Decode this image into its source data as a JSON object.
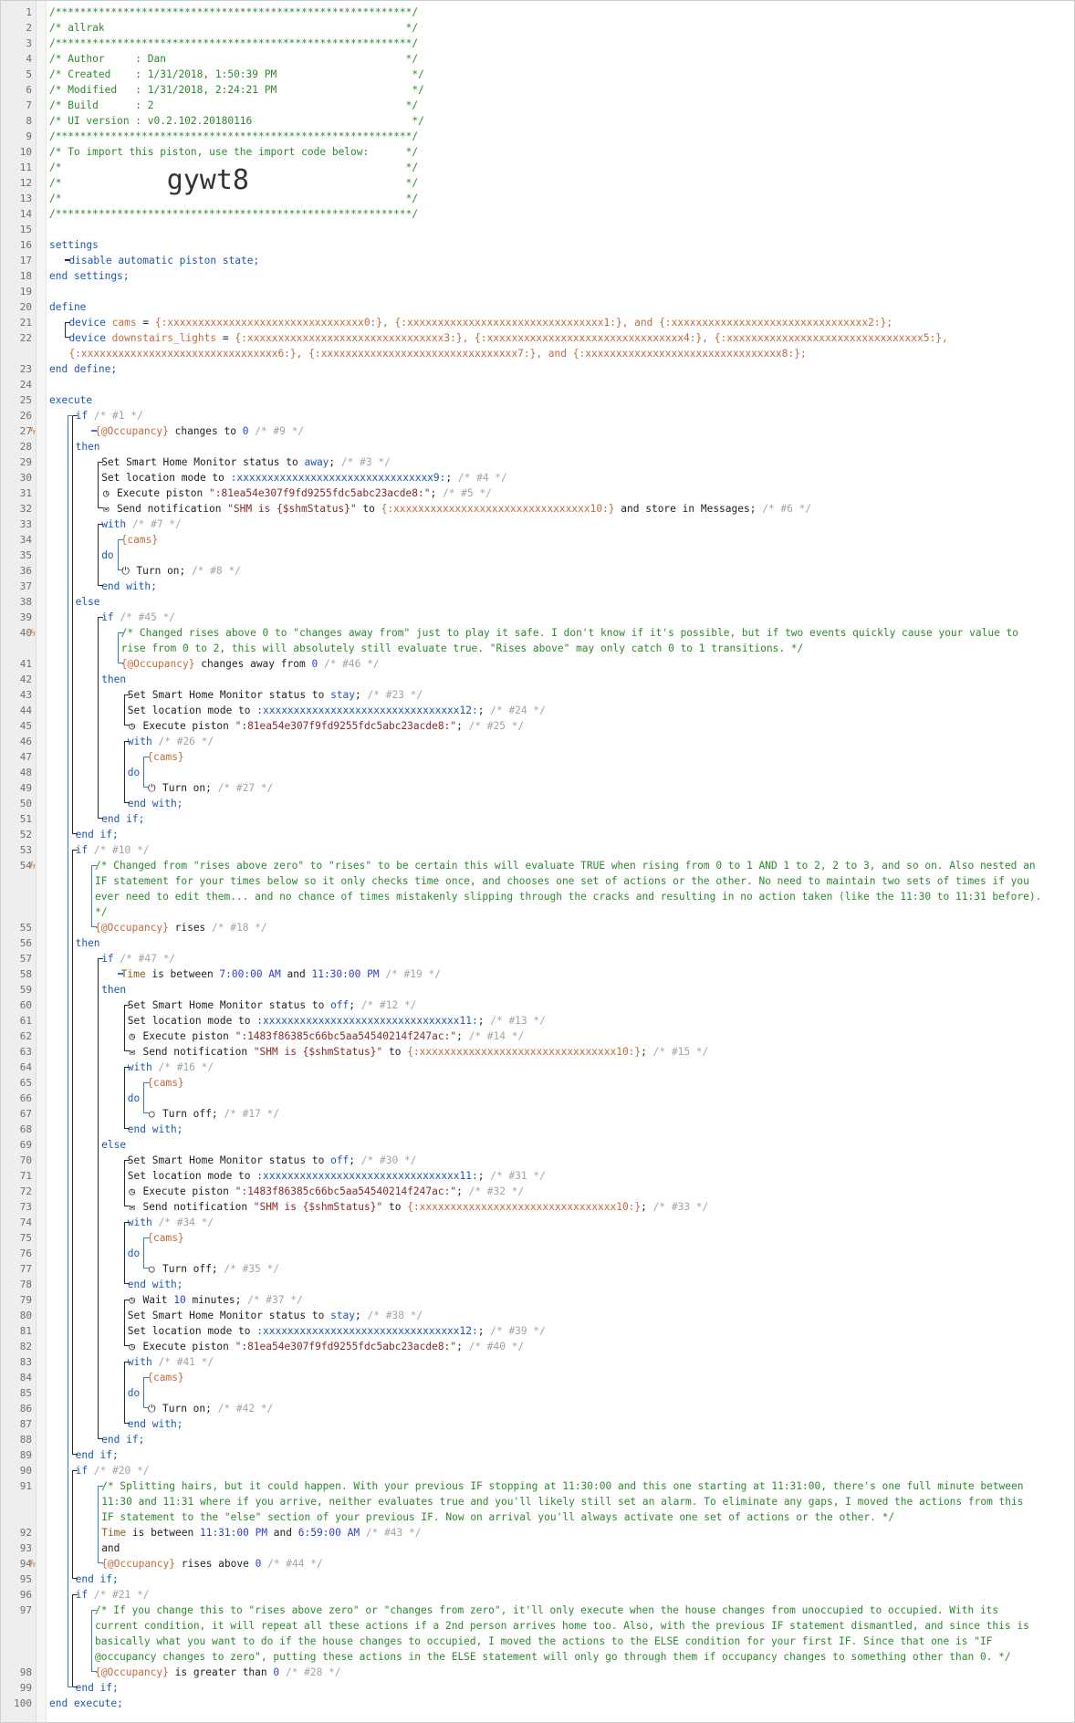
{
  "header_lines": [
    "/**********************************************************/",
    "/* allrak                                                 */",
    "/**********************************************************/",
    "/* Author     : Dan                                       */",
    "/* Created    : 1/31/2018, 1:50:39 PM                      */",
    "/* Modified   : 1/31/2018, 2:24:21 PM                      */",
    "/* Build      : 2                                         */",
    "/* UI version : v0.2.102.20180116                          */",
    "/**********************************************************/",
    "/* To import this piston, use the import code below:      */",
    "/*                                                        */",
    "/*                                                        */",
    "/*                                                        */",
    "/**********************************************************/"
  ],
  "import_code": "gywt8",
  "settings": {
    "open": "settings",
    "line": "disable automatic piston state;",
    "close": "end settings;"
  },
  "define": {
    "open": "define",
    "kw_device": "device",
    "cams_name": "cams",
    "cams_value": "{:xxxxxxxxxxxxxxxxxxxxxxxxxxxxxxxx0:}, {:xxxxxxxxxxxxxxxxxxxxxxxxxxxxxxxx1:}, and {:xxxxxxxxxxxxxxxxxxxxxxxxxxxxxxxx2:};",
    "lights_name": "downstairs_lights",
    "lights_value": "{:xxxxxxxxxxxxxxxxxxxxxxxxxxxxxxxx3:}, {:xxxxxxxxxxxxxxxxxxxxxxxxxxxxxxxx4:}, {:xxxxxxxxxxxxxxxxxxxxxxxxxxxxxxxx5:},",
    "lights_value2": "{:xxxxxxxxxxxxxxxxxxxxxxxxxxxxxxxx6:}, {:xxxxxxxxxxxxxxxxxxxxxxxxxxxxxxxx7:}, and {:xxxxxxxxxxxxxxxxxxxxxxxxxxxxxxxx8:};",
    "close": "end define;"
  },
  "tokens": {
    "execute": "execute",
    "end_execute": "end execute;",
    "if": "if",
    "then": "then",
    "else": "else",
    "end_if": "end if;",
    "with": "with",
    "do": "do",
    "end_with": "end with;",
    "and": "and",
    "occ": "{@Occupancy}",
    "cams": "{cams}",
    "zero": "0",
    "equals": "=",
    "comma": ",",
    "and_word": "and",
    "time": "Time",
    "is_between": " is between ",
    "and_sep": " and "
  },
  "comments": {
    "c1": "/* #1 */",
    "c9": "/* #9 */",
    "c3": "/* #3 */",
    "c4": "/* #4 */",
    "c5": "/* #5 */",
    "c6": "/* #6 */",
    "c7": "/* #7 */",
    "c8": "/* #8 */",
    "c45": "/* #45 */",
    "c46": "/* #46 */",
    "c23": "/* #23 */",
    "c24": "/* #24 */",
    "c25": "/* #25 */",
    "c26": "/* #26 */",
    "c27": "/* #27 */",
    "c10": "/* #10 */",
    "c18": "/* #18 */",
    "c47": "/* #47 */",
    "c19": "/* #19 */",
    "c12": "/* #12 */",
    "c13": "/* #13 */",
    "c14": "/* #14 */",
    "c15": "/* #15 */",
    "c16": "/* #16 */",
    "c17": "/* #17 */",
    "c30": "/* #30 */",
    "c31": "/* #31 */",
    "c32": "/* #32 */",
    "c33": "/* #33 */",
    "c34": "/* #34 */",
    "c35": "/* #35 */",
    "c37": "/* #37 */",
    "c38": "/* #38 */",
    "c39": "/* #39 */",
    "c40": "/* #40 */",
    "c41": "/* #41 */",
    "c42": "/* #42 */",
    "c20": "/* #20 */",
    "c43": "/* #43 */",
    "c44": "/* #44 */",
    "c21": "/* #21 */",
    "c28": "/* #28 */"
  },
  "text": {
    "changes_to": " changes to ",
    "changes_away_from": " changes away from ",
    "rises": " rises ",
    "rises_above": " rises above ",
    "is_greater_than": " is greater than ",
    "set_shm": "Set Smart Home Monitor status to ",
    "away": "away",
    "stay": "stay",
    "off": "off",
    "semi": ";",
    "set_location": "Set location mode to ",
    "loc9": ":xxxxxxxxxxxxxxxxxxxxxxxxxxxxxxxx9:",
    "loc12": ":xxxxxxxxxxxxxxxxxxxxxxxxxxxxxxxx12:",
    "loc11": ":xxxxxxxxxxxxxxxxxxxxxxxxxxxxxxxx11:",
    "execute_piston": "Execute piston ",
    "piston_a": "\":81ea54e307f9fd9255fdc5abc23acde8:\"",
    "piston_b": "\":1483f86385c66bc5aa54540214f247ac:\"",
    "send_notification": "Send notification ",
    "shm_msg": "\"SHM is {$shmStatus}\"",
    "to": " to ",
    "contact10": "{:xxxxxxxxxxxxxxxxxxxxxxxxxxxxxxxx10:}",
    "store_in_messages": " and store in Messages;",
    "turn_on": "Turn on;",
    "turn_off": "Turn off;",
    "wait": "Wait ",
    "ten": "10",
    "minutes": " minutes;",
    "t700": "7:00:00 AM",
    "t1130": "11:30:00 PM",
    "t1131": "11:31:00 PM",
    "t659": "6:59:00 AM"
  },
  "long_comments": {
    "c45a": "/* Changed rises above 0 to \"changes away from\" just to play it safe. I don't know if it's possible, but if two events quickly cause your value to",
    "c45b": "rise from 0 to 2, this will absolutely still evaluate true. \"Rises above\" may only catch 0 to 1 transitions. */",
    "c10a": "/* Changed from \"rises above zero\" to \"rises\" to be certain this will evaluate TRUE when rising from 0 to 1 AND 1 to 2, 2 to 3, and so on. Also nested an",
    "c10b": "IF statement for your times below so it only checks time once, and chooses one set of actions or the other. No need to maintain two sets of times if you",
    "c10c": "ever need to edit them... and no chance of times mistakenly slipping through the cracks and resulting in no action taken (like the 11:30 to 11:31 before).",
    "c10d": "*/",
    "c20a": "/* Splitting hairs, but it could happen. With your previous IF stopping at 11:30:00 and this one starting at 11:31:00, there's one full minute between",
    "c20b": "11:30 and 11:31 where if you arrive, neither evaluates true and you'll likely still set an alarm. To eliminate any gaps, I moved the actions from this",
    "c20c": "IF statement to the \"else\" section of your previous IF. Now on arrival you'll always activate one set of actions or the other. */",
    "c21a": "/* If you change this to \"rises above zero\" or \"changes from zero\", it'll only execute when the house changes from unoccupied to occupied. With its",
    "c21b": "current condition, it will repeat all these actions if a 2nd person arrives home too. Also, with the previous IF statement dismantled, and since this is",
    "c21c": "basically what you want to do if the house changes to occupied, I moved the actions to the ELSE condition for your first IF. Since that one is \"IF",
    "c21d": "@occupancy changes to zero\", putting these actions in the ELSE statement will only go through them if occupancy changes to something other than 0. */"
  },
  "line_numbers": [
    "1",
    "2",
    "3",
    "4",
    "5",
    "6",
    "7",
    "8",
    "9",
    "10",
    "11",
    "12",
    "13",
    "14",
    "15",
    "16",
    "17",
    "18",
    "19",
    "20",
    "21",
    "22",
    "23",
    "24",
    "25",
    "26",
    "27",
    "28",
    "29",
    "30",
    "31",
    "32",
    "33",
    "34",
    "35",
    "36",
    "37",
    "38",
    "39",
    "40",
    "41",
    "42",
    "43",
    "44",
    "45",
    "46",
    "47",
    "48",
    "49",
    "50",
    "51",
    "52",
    "53",
    "54",
    "55",
    "56",
    "57",
    "58",
    "59",
    "60",
    "61",
    "62",
    "63",
    "64",
    "65",
    "66",
    "67",
    "68",
    "69",
    "70",
    "71",
    "72",
    "73",
    "74",
    "75",
    "76",
    "77",
    "78",
    "79",
    "80",
    "81",
    "82",
    "83",
    "84",
    "85",
    "86",
    "87",
    "88",
    "89",
    "90",
    "91",
    "92",
    "93",
    "94",
    "95",
    "96",
    "97",
    "98",
    "99",
    "100"
  ],
  "trigger_icon": "ϟ"
}
